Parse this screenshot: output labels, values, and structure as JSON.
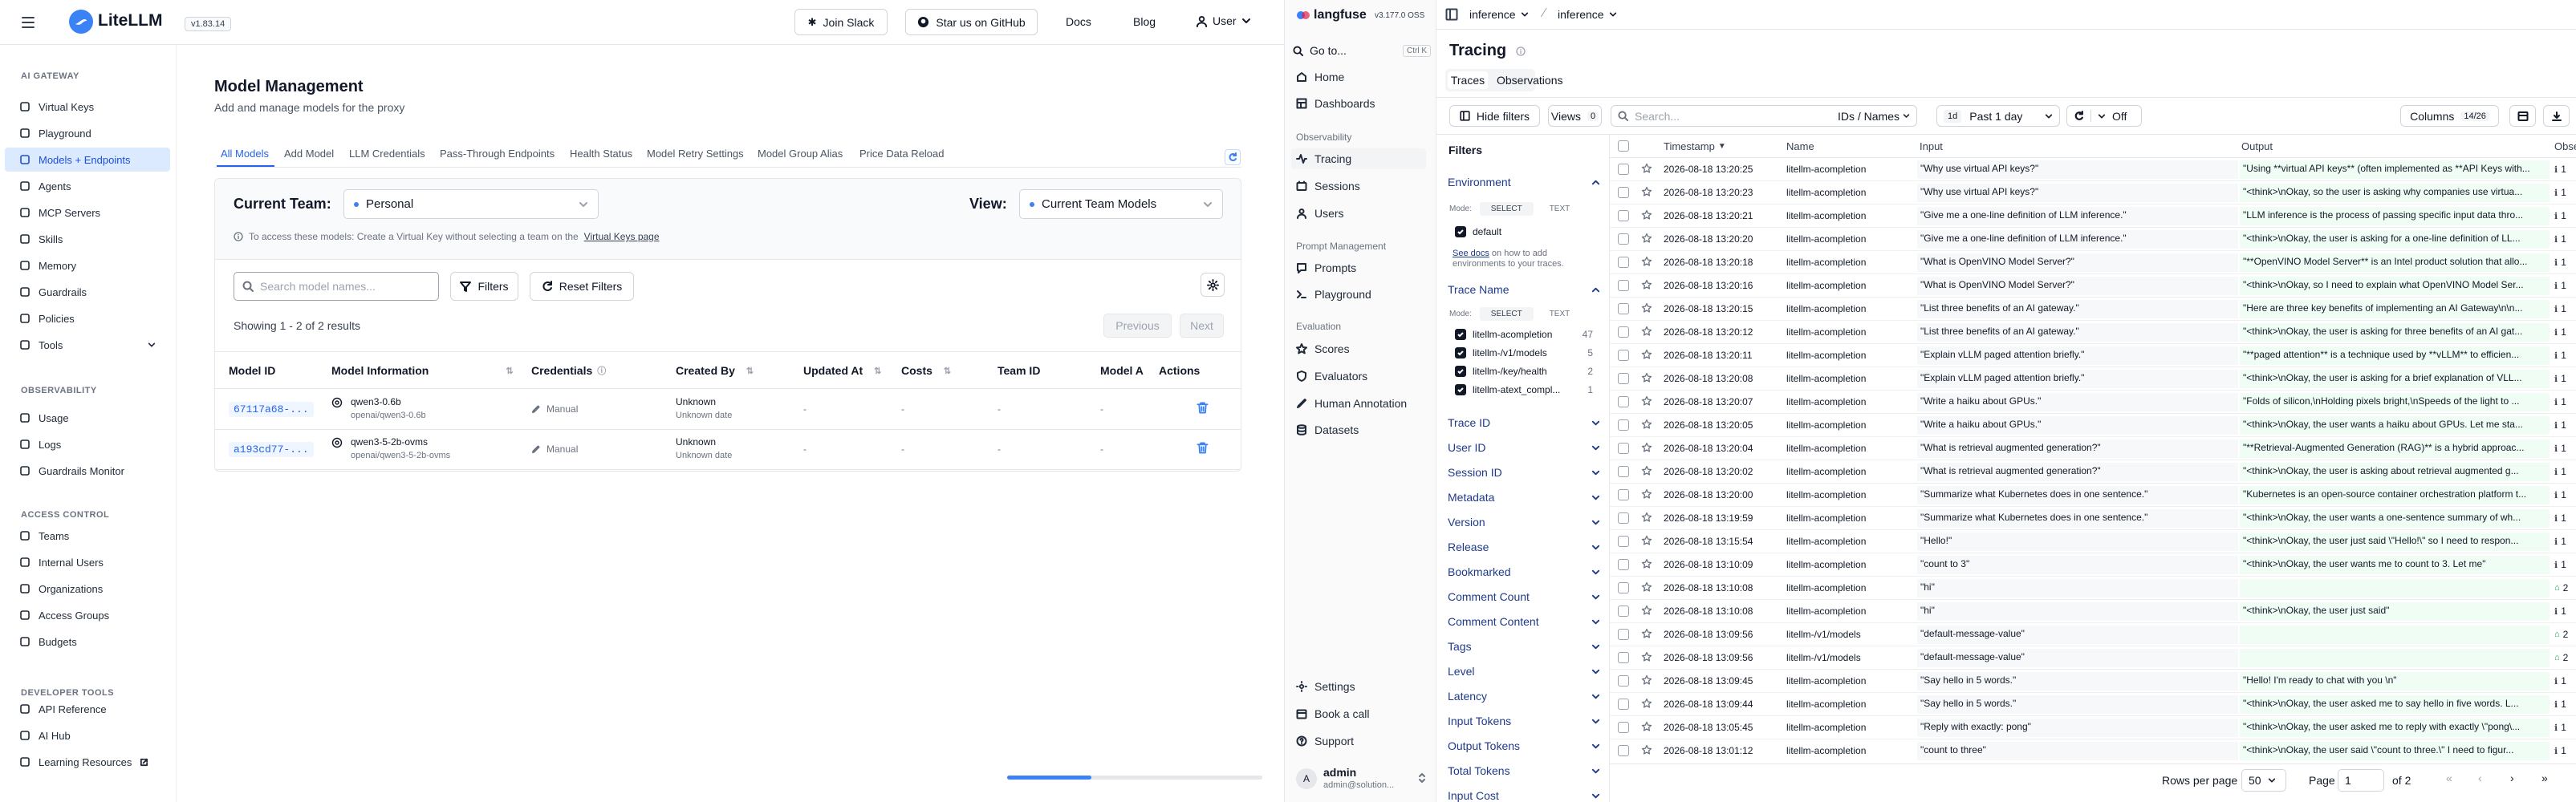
{
  "left": {
    "brand": "LiteLLM",
    "version": "v1.83.14",
    "top": {
      "join_slack": "Join Slack",
      "star_github": "Star us on GitHub",
      "docs": "Docs",
      "blog": "Blog",
      "user": "User"
    },
    "sections": {
      "ai_gateway": "AI GATEWAY",
      "observability": "OBSERVABILITY",
      "access": "ACCESS CONTROL",
      "dev": "DEVELOPER TOOLS"
    },
    "nav": [
      "Virtual Keys",
      "Playground",
      "Models + Endpoints",
      "Agents",
      "MCP Servers",
      "Skills",
      "Memory",
      "Guardrails",
      "Policies",
      "Tools",
      "Usage",
      "Logs",
      "Guardrails Monitor",
      "Teams",
      "Internal Users",
      "Organizations",
      "Access Groups",
      "Budgets",
      "API Reference",
      "AI Hub",
      "Learning Resources"
    ],
    "title": "Model Management",
    "subtitle": "Add and manage models for the proxy",
    "tabs": [
      "All Models",
      "Add Model",
      "LLM Credentials",
      "Pass-Through Endpoints",
      "Health Status",
      "Model Retry Settings",
      "Model Group Alias",
      "Price Data Reload"
    ],
    "current_team_label": "Current Team:",
    "team_value": "Personal",
    "view_label": "View:",
    "view_value": "Current Team Models",
    "info_text": "To access these models: Create a Virtual Key without selecting a team on the",
    "info_link": "Virtual Keys page",
    "search_placeholder": "Search model names...",
    "filters": "Filters",
    "reset_filters": "Reset Filters",
    "showing": "Showing 1 - 2 of 2 results",
    "previous": "Previous",
    "next": "Next",
    "columns": [
      "Model ID",
      "Model Information",
      "Credentials",
      "Created By",
      "Updated At",
      "Costs",
      "Team ID",
      "Model A",
      "Actions"
    ],
    "models": [
      {
        "id": "67117a68-...",
        "name": "qwen3-0.6b",
        "provider_model": "openai/qwen3-0.6b",
        "cred": "Manual",
        "created": "Unknown",
        "created_date": "Unknown date",
        "updated": "-",
        "costs": "-",
        "team": "-",
        "access": "-"
      },
      {
        "id": "a193cd77-...",
        "name": "qwen3-5-2b-ovms",
        "provider_model": "openai/qwen3-5-2b-ovms",
        "cred": "Manual",
        "created": "Unknown",
        "created_date": "Unknown date",
        "updated": "-",
        "costs": "-",
        "team": "-",
        "access": "-"
      }
    ],
    "scroll_progress": 0.33
  },
  "right": {
    "brand": "langfuse",
    "version": "v3.177.0 OSS",
    "org": "inference",
    "project": "inference",
    "nav": {
      "goto": "Go to...",
      "goto_kbd": "Ctrl K",
      "home": "Home",
      "dashboards": "Dashboards",
      "obs_section": "Observability",
      "tracing": "Tracing",
      "sessions": "Sessions",
      "users": "Users",
      "pm_section": "Prompt Management",
      "prompts": "Prompts",
      "playground": "Playground",
      "eval_section": "Evaluation",
      "scores": "Scores",
      "evaluators": "Evaluators",
      "human_annotation": "Human Annotation",
      "datasets": "Datasets",
      "settings": "Settings",
      "book_call": "Book a call",
      "support": "Support",
      "user_name": "admin",
      "user_email": "admin@solution...",
      "avatar": "A"
    },
    "title": "Tracing",
    "tabs": [
      "Traces",
      "Observations"
    ],
    "toolbar": {
      "hide_filters": "Hide filters",
      "views": "Views",
      "views_count": "0",
      "search_placeholder": "Search...",
      "ids_names": "IDs / Names",
      "range_short": "1d",
      "range": "Past 1 day",
      "refresh_off": "Off",
      "columns": "Columns",
      "columns_count": "14/26"
    },
    "filters": {
      "title": "Filters",
      "environment": "Environment",
      "mode": "Mode:",
      "select": "SELECT",
      "text": "TEXT",
      "env_default": "default",
      "see_docs": "See docs",
      "see_docs_rest": " on how to add environments to your traces.",
      "trace_name": "Trace Name",
      "trace_names": [
        {
          "name": "litellm-acompletion",
          "count": "47"
        },
        {
          "name": "litellm-/v1/models",
          "count": "5"
        },
        {
          "name": "litellm-/key/health",
          "count": "2"
        },
        {
          "name": "litellm-atext_compl...",
          "count": "1"
        }
      ],
      "sections": [
        "Trace ID",
        "User ID",
        "Session ID",
        "Metadata",
        "Version",
        "Release",
        "Bookmarked",
        "Comment Count",
        "Comment Content",
        "Tags",
        "Level",
        "Latency",
        "Input Tokens",
        "Output Tokens",
        "Total Tokens",
        "Input Cost"
      ]
    },
    "columns": {
      "timestamp": "Timestamp",
      "name": "Name",
      "input": "Input",
      "output": "Output",
      "obs": "Obse"
    },
    "traces": [
      {
        "ts": "2026-08-18 13:20:25",
        "name": "litellm-acompletion",
        "input": "\"Why use virtual API keys?\"",
        "output": "\"Using **virtual API keys** (often implemented as **API Keys with...",
        "obs": "1",
        "err": false
      },
      {
        "ts": "2026-08-18 13:20:23",
        "name": "litellm-acompletion",
        "input": "\"Why use virtual API keys?\"",
        "output": "\"<think>\\nOkay, so the user is asking why companies use virtua...",
        "obs": "1",
        "err": false
      },
      {
        "ts": "2026-08-18 13:20:21",
        "name": "litellm-acompletion",
        "input": "\"Give me a one-line definition of LLM inference.\"",
        "output": "\"LLM inference is the process of passing specific input data thro...",
        "obs": "1",
        "err": false
      },
      {
        "ts": "2026-08-18 13:20:20",
        "name": "litellm-acompletion",
        "input": "\"Give me a one-line definition of LLM inference.\"",
        "output": "\"<think>\\nOkay, the user is asking for a one-line definition of LL...",
        "obs": "1",
        "err": false
      },
      {
        "ts": "2026-08-18 13:20:18",
        "name": "litellm-acompletion",
        "input": "\"What is OpenVINO Model Server?\"",
        "output": "\"**OpenVINO Model Server** is an Intel product solution that allo...",
        "obs": "1",
        "err": false
      },
      {
        "ts": "2026-08-18 13:20:16",
        "name": "litellm-acompletion",
        "input": "\"What is OpenVINO Model Server?\"",
        "output": "\"<think>\\nOkay, so I need to explain what OpenVINO Model Ser...",
        "obs": "1",
        "err": false
      },
      {
        "ts": "2026-08-18 13:20:15",
        "name": "litellm-acompletion",
        "input": "\"List three benefits of an AI gateway.\"",
        "output": "\"Here are three key benefits of implementing an AI Gateway\\n\\n...",
        "obs": "1",
        "err": false
      },
      {
        "ts": "2026-08-18 13:20:12",
        "name": "litellm-acompletion",
        "input": "\"List three benefits of an AI gateway.\"",
        "output": "\"<think>\\nOkay, the user is asking for three benefits of an AI gat...",
        "obs": "1",
        "err": false
      },
      {
        "ts": "2026-08-18 13:20:11",
        "name": "litellm-acompletion",
        "input": "\"Explain vLLM paged attention briefly.\"",
        "output": "\"**paged attention** is a technique used by **vLLM** to efficien...",
        "obs": "1",
        "err": false
      },
      {
        "ts": "2026-08-18 13:20:08",
        "name": "litellm-acompletion",
        "input": "\"Explain vLLM paged attention briefly.\"",
        "output": "\"<think>\\nOkay, the user is asking for a brief explanation of VLL...",
        "obs": "1",
        "err": false
      },
      {
        "ts": "2026-08-18 13:20:07",
        "name": "litellm-acompletion",
        "input": "\"Write a haiku about GPUs.\"",
        "output": "\"Folds of silicon,\\nHolding pixels bright,\\nSpeeds of the light to ...",
        "obs": "1",
        "err": false
      },
      {
        "ts": "2026-08-18 13:20:05",
        "name": "litellm-acompletion",
        "input": "\"Write a haiku about GPUs.\"",
        "output": "\"<think>\\nOkay, the user wants a haiku about GPUs. Let me sta...",
        "obs": "1",
        "err": false
      },
      {
        "ts": "2026-08-18 13:20:04",
        "name": "litellm-acompletion",
        "input": "\"What is retrieval augmented generation?\"",
        "output": "\"**Retrieval-Augmented Generation (RAG)** is a hybrid approac...",
        "obs": "1",
        "err": false
      },
      {
        "ts": "2026-08-18 13:20:02",
        "name": "litellm-acompletion",
        "input": "\"What is retrieval augmented generation?\"",
        "output": "\"<think>\\nOkay, the user is asking about retrieval augmented g...",
        "obs": "1",
        "err": false
      },
      {
        "ts": "2026-08-18 13:20:00",
        "name": "litellm-acompletion",
        "input": "\"Summarize what Kubernetes does in one sentence.\"",
        "output": "\"Kubernetes is an open-source container orchestration platform t...",
        "obs": "1",
        "err": false
      },
      {
        "ts": "2026-08-18 13:19:59",
        "name": "litellm-acompletion",
        "input": "\"Summarize what Kubernetes does in one sentence.\"",
        "output": "\"<think>\\nOkay, the user wants a one-sentence summary of wh...",
        "obs": "1",
        "err": false
      },
      {
        "ts": "2026-08-18 13:15:54",
        "name": "litellm-acompletion",
        "input": "\"Hello!\"",
        "output": "\"<think>\\nOkay, the user just said \\\"Hello!\\\" so I need to respon...",
        "obs": "1",
        "err": false
      },
      {
        "ts": "2026-08-18 13:10:09",
        "name": "litellm-acompletion",
        "input": "\"count to 3\"",
        "output": "\"<think>\\nOkay, the user wants me to count to 3. Let me\"",
        "obs": "1",
        "err": false
      },
      {
        "ts": "2026-08-18 13:10:08",
        "name": "litellm-acompletion",
        "input": "\"hi\"",
        "output": "",
        "obs": "2",
        "err": true
      },
      {
        "ts": "2026-08-18 13:10:08",
        "name": "litellm-acompletion",
        "input": "\"hi\"",
        "output": "\"<think>\\nOkay, the user just said\"",
        "obs": "1",
        "err": false
      },
      {
        "ts": "2026-08-18 13:09:56",
        "name": "litellm-/v1/models",
        "input": "\"default-message-value\"",
        "output": "",
        "obs": "2",
        "err": true
      },
      {
        "ts": "2026-08-18 13:09:56",
        "name": "litellm-/v1/models",
        "input": "\"default-message-value\"",
        "output": "",
        "obs": "2",
        "err": true
      },
      {
        "ts": "2026-08-18 13:09:45",
        "name": "litellm-acompletion",
        "input": "\"Say hello in 5 words.\"",
        "output": "\"Hello! I'm ready to chat with you \\n\"",
        "obs": "1",
        "err": false
      },
      {
        "ts": "2026-08-18 13:09:44",
        "name": "litellm-acompletion",
        "input": "\"Say hello in 5 words.\"",
        "output": "\"<think>\\nOkay, the user asked me to say hello in five words. L...",
        "obs": "1",
        "err": false
      },
      {
        "ts": "2026-08-18 13:05:45",
        "name": "litellm-acompletion",
        "input": "\"Reply with exactly: pong\"",
        "output": "\"<think>\\nOkay, the user asked me to reply with exactly \\\"pong\\...",
        "obs": "1",
        "err": false
      },
      {
        "ts": "2026-08-18 13:01:12",
        "name": "litellm-acompletion",
        "input": "\"count to three\"",
        "output": "\"<think>\\nOkay, the user said \\\"count to three.\\\" I need to figur...",
        "obs": "1",
        "err": false
      }
    ],
    "pagination": {
      "rows_per_page": "Rows per page",
      "rows_value": "50",
      "page_label": "Page",
      "page_value": "1",
      "of": "of 2"
    }
  }
}
